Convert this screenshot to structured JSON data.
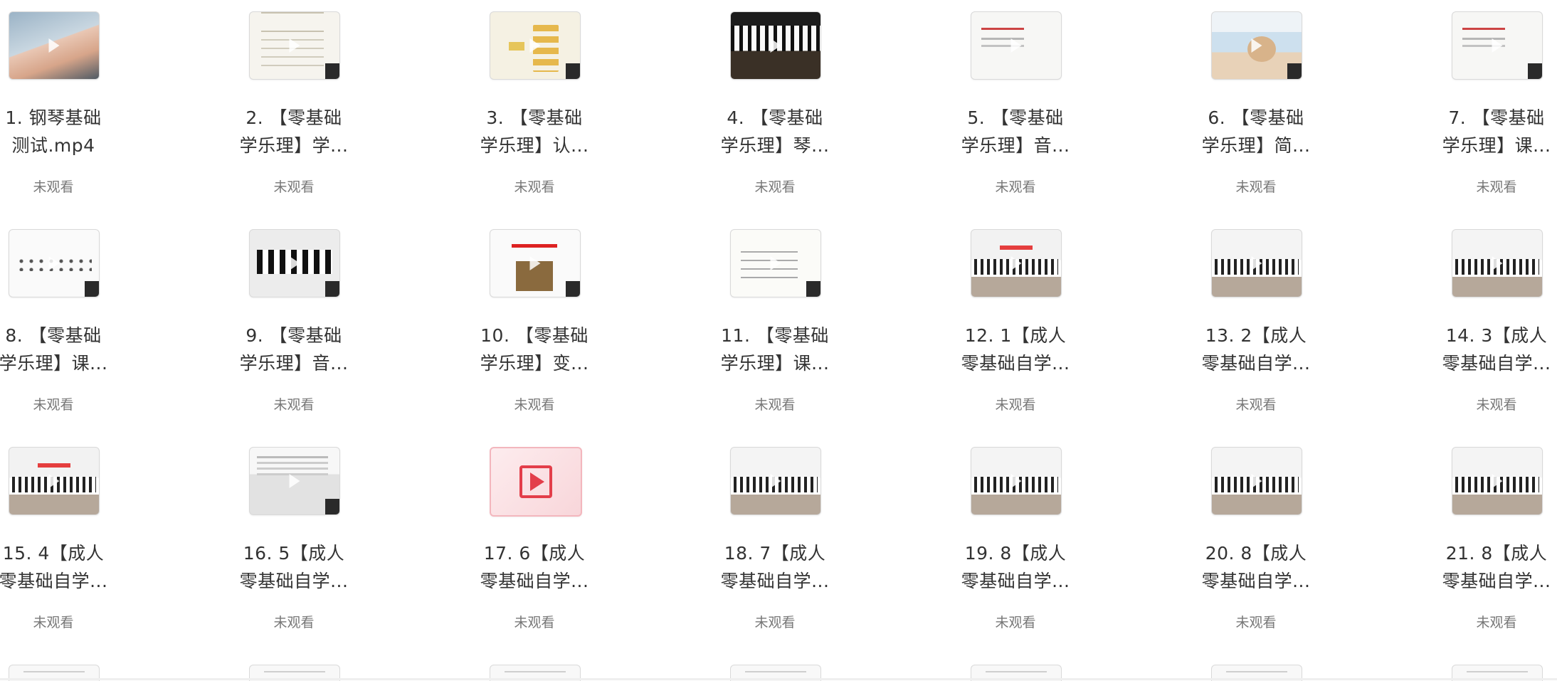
{
  "videos": [
    {
      "line1": "1. 钢琴基础",
      "line2": "测试.mp4",
      "status": "未观看"
    },
    {
      "line1": "2. 【零基础",
      "line2": "学乐理】学...",
      "status": "未观看"
    },
    {
      "line1": "3. 【零基础",
      "line2": "学乐理】认...",
      "status": "未观看"
    },
    {
      "line1": "4. 【零基础",
      "line2": "学乐理】琴...",
      "status": "未观看"
    },
    {
      "line1": "5. 【零基础",
      "line2": "学乐理】音...",
      "status": "未观看"
    },
    {
      "line1": "6. 【零基础",
      "line2": "学乐理】简...",
      "status": "未观看"
    },
    {
      "line1": "7. 【零基础",
      "line2": "学乐理】课...",
      "status": "未观看"
    },
    {
      "line1": "8. 【零基础",
      "line2": "学乐理】课...",
      "status": "未观看"
    },
    {
      "line1": "9. 【零基础",
      "line2": "学乐理】音...",
      "status": "未观看"
    },
    {
      "line1": "10. 【零基础",
      "line2": "学乐理】变...",
      "status": "未观看"
    },
    {
      "line1": "11. 【零基础",
      "line2": "学乐理】课...",
      "status": "未观看"
    },
    {
      "line1": "12. 1【成人",
      "line2": "零基础自学...",
      "status": "未观看"
    },
    {
      "line1": "13. 2【成人",
      "line2": "零基础自学...",
      "status": "未观看"
    },
    {
      "line1": "14. 3【成人",
      "line2": "零基础自学...",
      "status": "未观看"
    },
    {
      "line1": "15. 4【成人",
      "line2": "零基础自学...",
      "status": "未观看"
    },
    {
      "line1": "16. 5【成人",
      "line2": "零基础自学...",
      "status": "未观看"
    },
    {
      "line1": "17. 6【成人",
      "line2": "零基础自学...",
      "status": "未观看"
    },
    {
      "line1": "18. 7【成人",
      "line2": "零基础自学...",
      "status": "未观看"
    },
    {
      "line1": "19. 8【成人",
      "line2": "零基础自学...",
      "status": "未观看"
    },
    {
      "line1": "20. 8【成人",
      "line2": "零基础自学...",
      "status": "未观看"
    },
    {
      "line1": "21. 8【成人",
      "line2": "零基础自学...",
      "status": "未观看"
    }
  ],
  "thumbnail_icons": [
    "play-icon"
  ],
  "accent_colors": {
    "placeholder_play": "#e33e4a",
    "status_text": "#777777",
    "title_text": "#333333"
  }
}
